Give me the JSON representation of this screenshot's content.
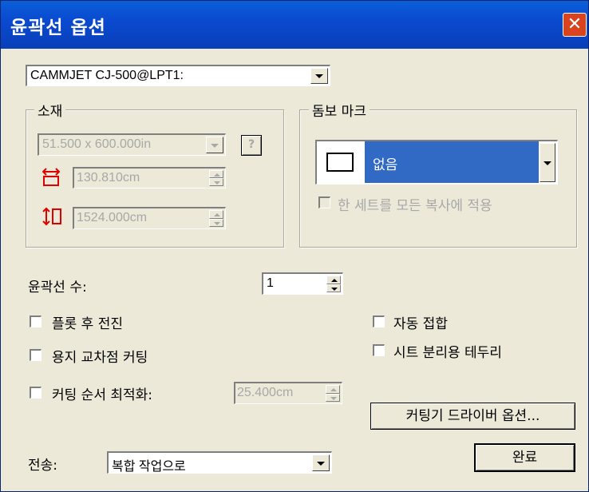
{
  "window": {
    "title": "윤곽선 옵션",
    "close_glyph": "✕"
  },
  "device": {
    "selected": "CAMMJET CJ-500@LPT1:"
  },
  "material": {
    "legend": "소재",
    "size_selected": "51.500 x 600.000in",
    "help_glyph": "?",
    "width_value": "130.810cm",
    "height_value": "1524.000cm"
  },
  "dombo": {
    "legend": "돔보 마크",
    "selected": "없음",
    "apply_all_label": "한 세트를 모든 복사에 적용"
  },
  "contour_count": {
    "label": "윤곽선 수:",
    "value": "1"
  },
  "options": {
    "plot_feed": "플롯 후 전진",
    "paper_cross_cut": "용지 교차점 커팅",
    "optimize_order": "커팅 순서 최적화:",
    "optimize_value": "25.400cm",
    "auto_weld": "자동 접합",
    "sheet_border": "시트 분리용 테두리"
  },
  "buttons": {
    "cutter_driver": "커팅기 드라이버 옵션...",
    "done": "완료"
  },
  "send": {
    "label": "전송:",
    "selected": "복합 작업으로"
  },
  "colors": {
    "title_blue": "#0a4ad0",
    "select_blue": "#316ac5",
    "close_red": "#d9441f",
    "face": "#ece9d8",
    "icon_red": "#e00000"
  }
}
